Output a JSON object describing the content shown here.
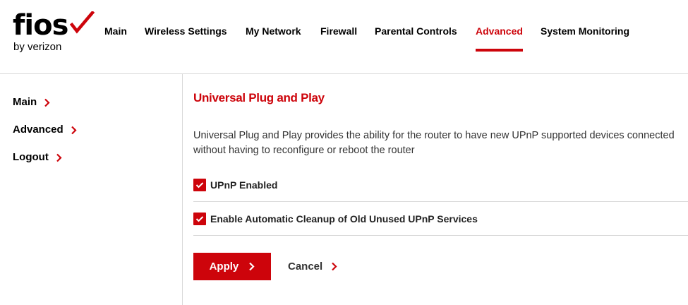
{
  "logo": {
    "brand": "fios",
    "subtitle": "by verizon",
    "icon": "checkmark-icon"
  },
  "colors": {
    "accent": "#cd040b",
    "text": "#000000",
    "divider": "#d9d9d9"
  },
  "nav": {
    "items": [
      {
        "label": "Main"
      },
      {
        "label": "Wireless Settings"
      },
      {
        "label": "My Network"
      },
      {
        "label": "Firewall"
      },
      {
        "label": "Parental Controls"
      },
      {
        "label": "Advanced",
        "active": true
      },
      {
        "label": "System Monitoring"
      }
    ]
  },
  "sidebar": {
    "items": [
      {
        "label": "Main"
      },
      {
        "label": "Advanced"
      },
      {
        "label": "Logout"
      }
    ]
  },
  "main": {
    "title": "Universal Plug and Play",
    "description": "Universal Plug and Play provides the ability for the router to have new UPnP supported devices connected without having to reconfigure or reboot the router",
    "options": [
      {
        "label": "UPnP Enabled",
        "checked": true
      },
      {
        "label": "Enable Automatic Cleanup of Old Unused UPnP Services",
        "checked": true
      }
    ],
    "apply_label": "Apply",
    "cancel_label": "Cancel"
  }
}
